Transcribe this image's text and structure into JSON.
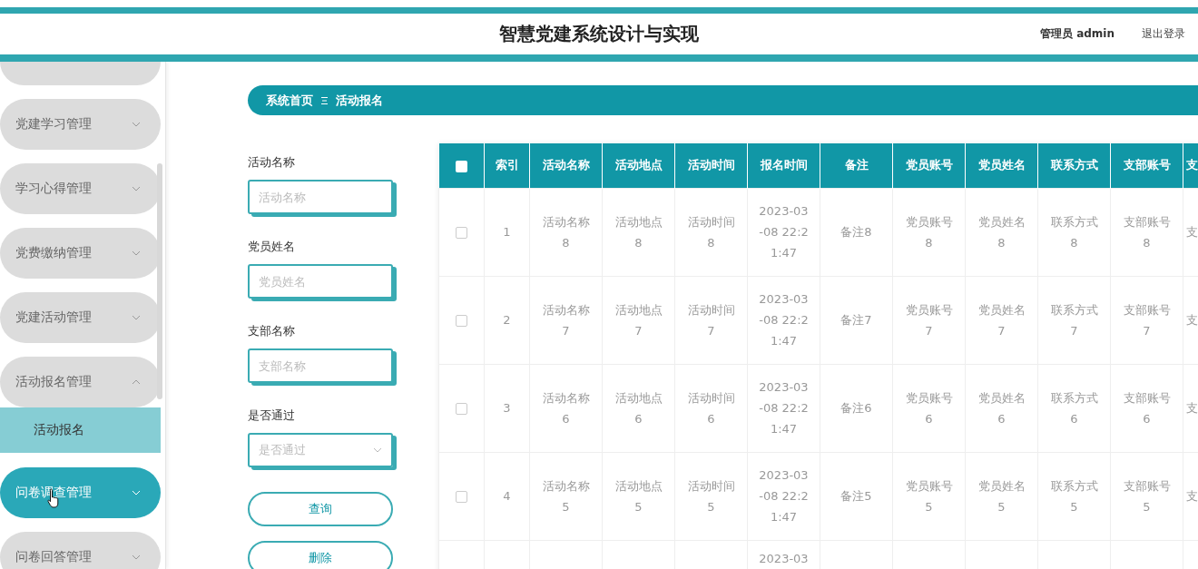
{
  "header": {
    "title": "智慧党建系统设计与实现",
    "user": "管理员 admin",
    "logout": "退出登录"
  },
  "sidebar": {
    "items": [
      {
        "label": "党建学习管理",
        "expanded": false,
        "hovered": false
      },
      {
        "label": "学习心得管理",
        "expanded": false,
        "hovered": false
      },
      {
        "label": "党费缴纳管理",
        "expanded": false,
        "hovered": false
      },
      {
        "label": "党建活动管理",
        "expanded": false,
        "hovered": false
      },
      {
        "label": "活动报名管理",
        "expanded": true,
        "hovered": false,
        "children": [
          {
            "label": "活动报名",
            "selected": true
          }
        ]
      },
      {
        "label": "问卷调查管理",
        "expanded": false,
        "hovered": true
      },
      {
        "label": "问卷回答管理",
        "expanded": false,
        "hovered": false
      }
    ]
  },
  "breadcrumb": [
    "系统首页",
    "活动报名"
  ],
  "filters": [
    {
      "kind": "input",
      "label": "活动名称",
      "placeholder": "活动名称"
    },
    {
      "kind": "input",
      "label": "党员姓名",
      "placeholder": "党员姓名"
    },
    {
      "kind": "input",
      "label": "支部名称",
      "placeholder": "支部名称"
    },
    {
      "kind": "select",
      "label": "是否通过",
      "placeholder": "是否通过"
    }
  ],
  "buttons": [
    "查询",
    "删除"
  ],
  "table": {
    "all_selected": false,
    "columns": [
      "索引",
      "活动名称",
      "活动地点",
      "活动时间",
      "报名时间",
      "备注",
      "党员账号",
      "党员姓名",
      "联系方式",
      "支部账号",
      "支"
    ],
    "rows": [
      {
        "selected": false,
        "cells": [
          "1",
          "活动名称8",
          "活动地点8",
          "活动时间8",
          "2023-03-08 22:21:47",
          "备注8",
          "党员账号8",
          "党员姓名8",
          "联系方式8",
          "支部账号8",
          "支"
        ]
      },
      {
        "selected": false,
        "cells": [
          "2",
          "活动名称7",
          "活动地点7",
          "活动时间7",
          "2023-03-08 22:21:47",
          "备注7",
          "党员账号7",
          "党员姓名7",
          "联系方式7",
          "支部账号7",
          "支"
        ]
      },
      {
        "selected": false,
        "cells": [
          "3",
          "活动名称6",
          "活动地点6",
          "活动时间6",
          "2023-03-08 22:21:47",
          "备注6",
          "党员账号6",
          "党员姓名6",
          "联系方式6",
          "支部账号6",
          "支"
        ]
      },
      {
        "selected": false,
        "cells": [
          "4",
          "活动名称5",
          "活动地点5",
          "活动时间5",
          "2023-03-08 22:21:47",
          "备注5",
          "党员账号5",
          "党员姓名5",
          "联系方式5",
          "支部账号5",
          "支"
        ]
      },
      {
        "cells": [
          "",
          "",
          "",
          "",
          "2023-03",
          "",
          "",
          "",
          "",
          "",
          ""
        ]
      }
    ]
  }
}
